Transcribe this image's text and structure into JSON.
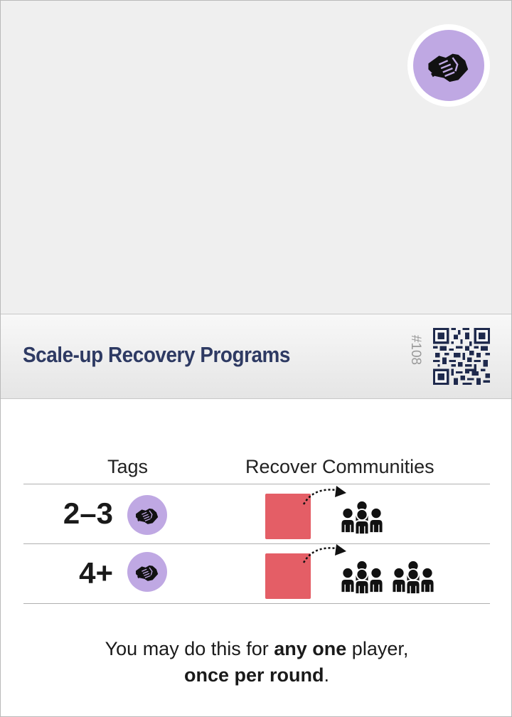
{
  "card": {
    "title": "Scale-up Recovery Programs",
    "number": "#108",
    "category_icon": "handshake-icon",
    "colors": {
      "title": "#2e3a63",
      "tag_circle": "#bfa8e3",
      "resource": "#e45e66"
    }
  },
  "table": {
    "header_tags": "Tags",
    "header_effect": "Recover Communities",
    "rows": [
      {
        "count": "2–3",
        "tag_icon": "handshake-icon",
        "cost_icon": "red-square",
        "result_icon": "community-icon",
        "result_count": 1
      },
      {
        "count": "4+",
        "tag_icon": "handshake-icon",
        "cost_icon": "red-square",
        "result_icon": "community-icon",
        "result_count": 2
      }
    ]
  },
  "rule_text": {
    "part1": "You may do this for ",
    "bold1": "any one",
    "part2": " player,",
    "bold2": "once per round",
    "part3": "."
  }
}
